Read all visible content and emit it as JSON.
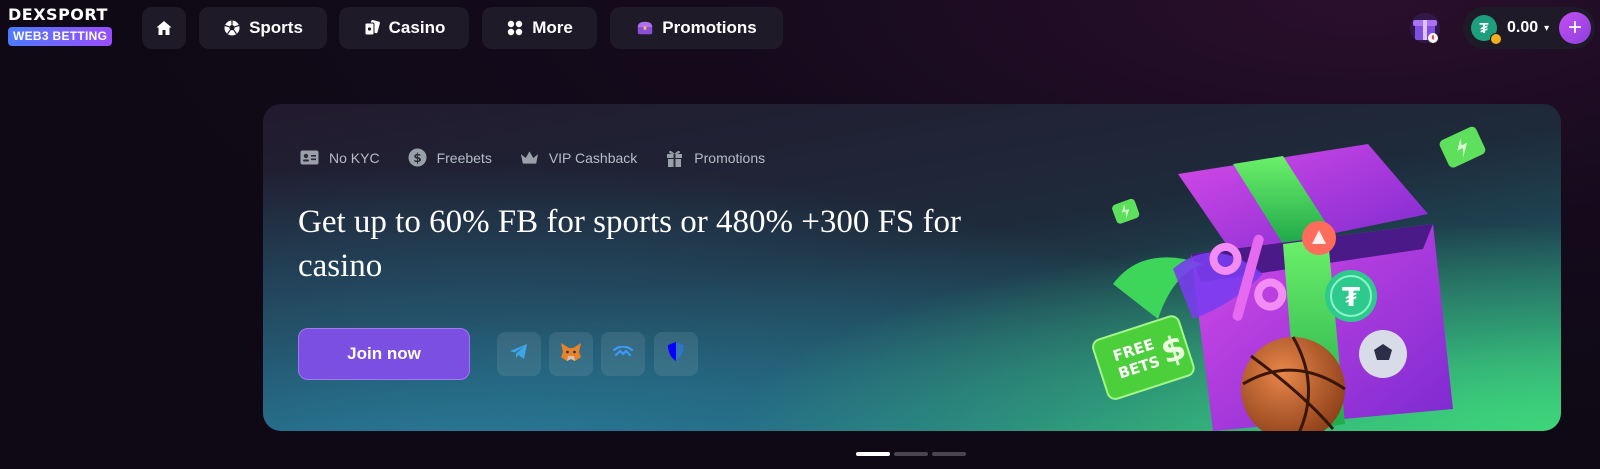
{
  "header": {
    "logo": {
      "title": "DEXSPORT",
      "badge": "WEB3 BETTING"
    },
    "nav": {
      "home_icon": "home-icon",
      "sports": "Sports",
      "casino": "Casino",
      "more": "More",
      "promotions": "Promotions"
    },
    "wallet": {
      "currency_icon": "tether-icon",
      "balance": "0.00",
      "caret": "▾",
      "add": "+"
    }
  },
  "banner": {
    "tags": [
      {
        "icon": "id-card-icon",
        "label": "No KYC"
      },
      {
        "icon": "dollar-coin-icon",
        "label": "Freebets"
      },
      {
        "icon": "crown-icon",
        "label": "VIP Cashback"
      },
      {
        "icon": "gift-icon",
        "label": "Promotions"
      }
    ],
    "headline": "Get up to 60% FB for sports or 480% +300 FS for casino",
    "join_label": "Join now",
    "social": [
      "telegram-icon",
      "metamask-icon",
      "walletconnect-icon",
      "trustwallet-icon"
    ],
    "art_text": "FREE BETS"
  },
  "pager": {
    "count": 3,
    "active": 0
  },
  "colors": {
    "accent": "#7a4fe2",
    "banner_green": "#3ed67a",
    "plus_button": "#b04eee"
  }
}
